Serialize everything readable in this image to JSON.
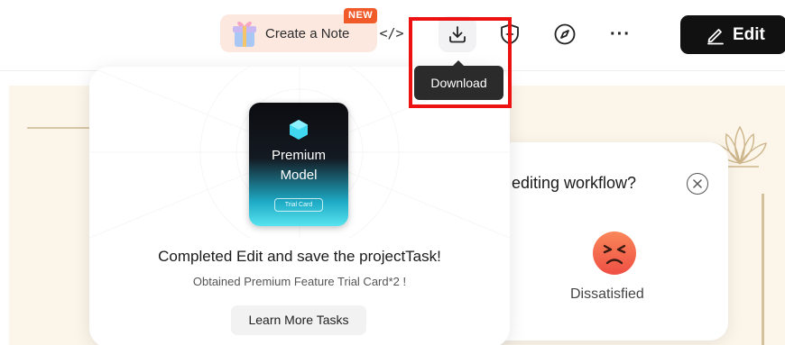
{
  "toolbar": {
    "create_note_label": "Create a Note",
    "new_badge": "NEW",
    "code_icon_glyph": "</>",
    "download_tooltip": "Download",
    "more_glyph": "···",
    "edit_label": "Edit"
  },
  "task_card": {
    "premium_title_line1": "Premium",
    "premium_title_line2": "Model",
    "trial_tag": "Trial Card",
    "title": "Completed Edit and save the projectTask!",
    "subtitle": "Obtained Premium Feature Trial Card*2 !",
    "learn_more_label": "Learn More Tasks"
  },
  "survey": {
    "question": "editing workflow?",
    "rating_label": "Dissatisfied"
  },
  "colors": {
    "highlight": "#ee1111",
    "new_badge": "#f15a29",
    "edit_button": "#111111",
    "emoji_face": "#f46a4a"
  },
  "icons": [
    "gift-icon",
    "code-icon",
    "download-icon",
    "ai-shield-icon",
    "compass-icon",
    "more-icon",
    "pencil-icon",
    "gem-icon",
    "close-icon",
    "angry-face-icon"
  ]
}
